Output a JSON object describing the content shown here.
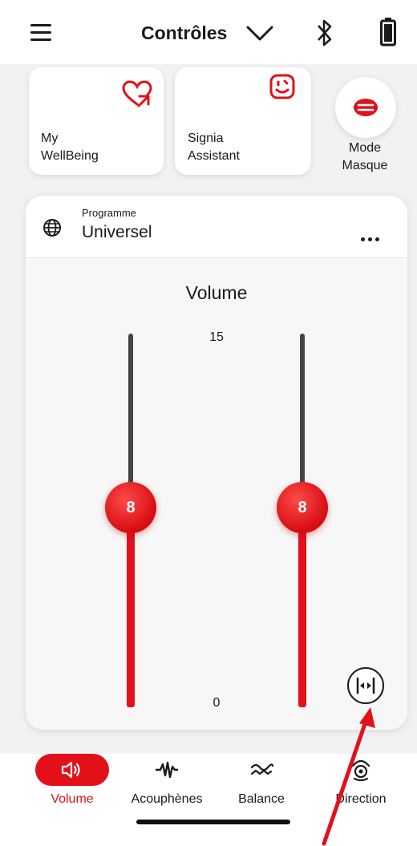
{
  "header": {
    "title": "Contrôles",
    "icons": [
      "menu-icon",
      "chevron-down-icon",
      "bluetooth-icon",
      "battery-icon"
    ]
  },
  "tiles": {
    "wellbeing": {
      "label_line1": "My",
      "label_line2": "WellBeing",
      "icon": "heart-arrow-icon"
    },
    "assistant": {
      "label_line1": "Signia",
      "label_line2": "Assistant",
      "icon": "assistant-face-icon"
    },
    "mask": {
      "label_line1": "Mode",
      "label_line2": "Masque",
      "icon": "face-mask-icon"
    }
  },
  "program": {
    "caption": "Programme",
    "name": "Universel",
    "icon": "globe-icon"
  },
  "volume": {
    "title": "Volume",
    "max_label": "15",
    "min_label": "0",
    "left_value": "8",
    "right_value": "8",
    "left_level": 8,
    "right_level": 8,
    "scale_max": 15
  },
  "nav": {
    "items": [
      {
        "label": "Volume",
        "icon": "speaker-icon",
        "active": true
      },
      {
        "label": "Acouphènes",
        "icon": "tinnitus-wave-icon",
        "active": false
      },
      {
        "label": "Balance",
        "icon": "balance-wave-icon",
        "active": false
      },
      {
        "label": "Direction",
        "icon": "direction-icon",
        "active": false
      }
    ]
  },
  "colors": {
    "accent": "#e3101a",
    "track_dark": "#444444",
    "background": "#f2f2f3"
  }
}
